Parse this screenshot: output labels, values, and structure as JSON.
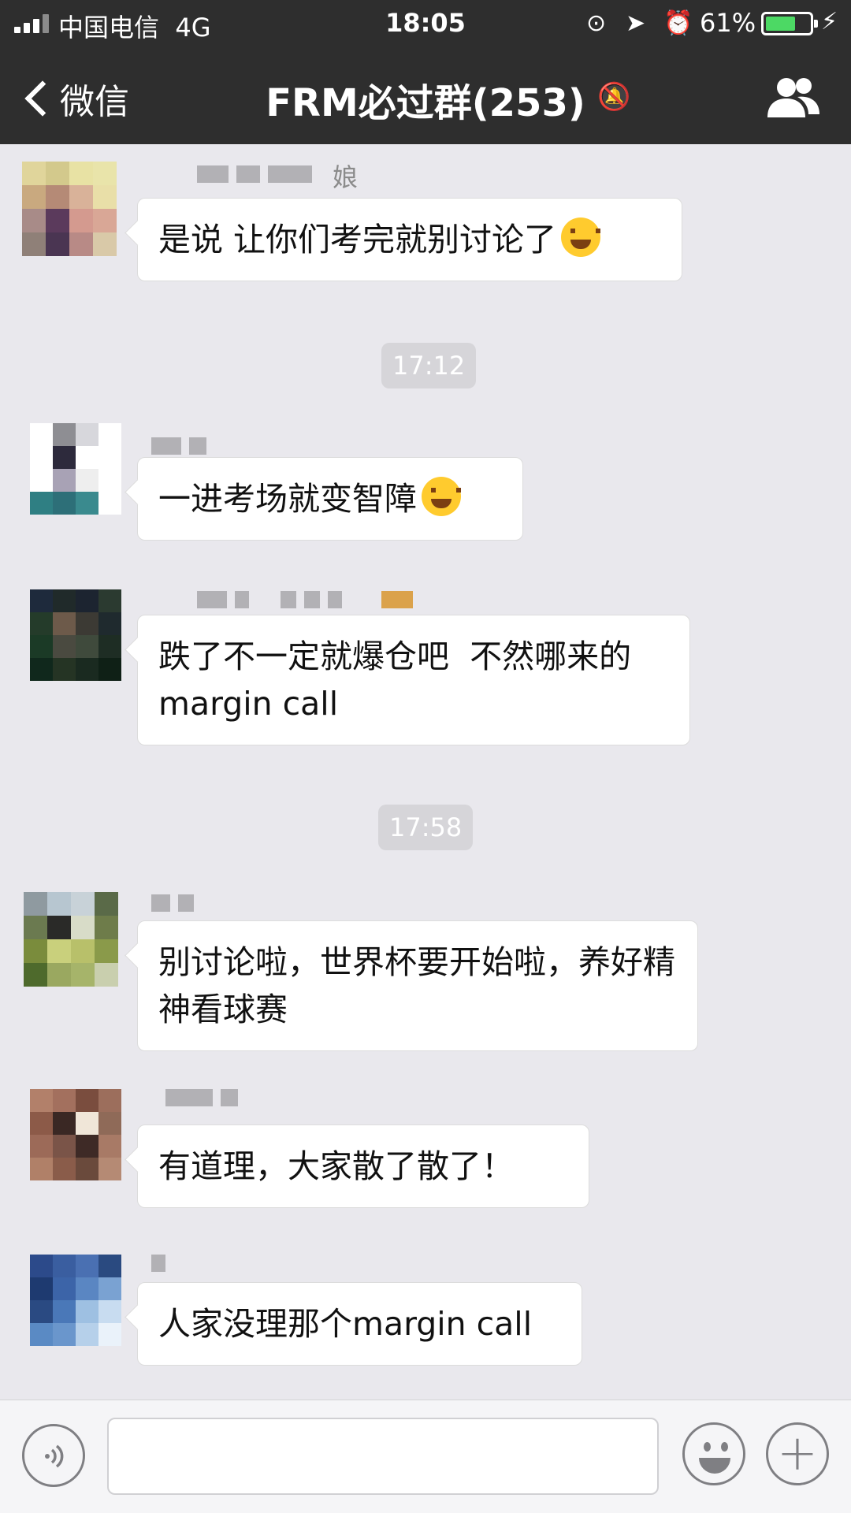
{
  "status_bar": {
    "carrier": "中国电信",
    "network": "4G",
    "time": "18:05",
    "battery_percent": "61%",
    "battery_level": 0.61,
    "icons": [
      "lock-rotation-icon",
      "location-arrow-icon",
      "alarm-icon",
      "charging-bolt-icon"
    ]
  },
  "nav": {
    "back_label": "微信",
    "title": "FRM必过群(253)",
    "mute_icon": "mute-bell-icon",
    "members_icon": "group-members-icon"
  },
  "messages": [
    {
      "name_suffix": "娘",
      "text": "是说 让你们考完就别讨论了",
      "emoji": "grinning-sweat-emoji"
    },
    {
      "text": "一进考场就变智障",
      "emoji": "face-palm-emoji"
    },
    {
      "text": "跌了不一定就爆仓吧  不然哪来的margin call"
    },
    {
      "text": "别讨论啦，世界杯要开始啦，养好精神看球赛"
    },
    {
      "text": "有道理，大家散了散了！"
    },
    {
      "text": "人家没理那个margin call"
    }
  ],
  "timestamps": [
    "17:12",
    "17:58"
  ],
  "input_bar": {
    "voice_icon": "voice-icon",
    "emoji_icon": "emoji-face-icon",
    "plus_icon": "plus-icon"
  },
  "colors": {
    "nav_bg": "#2e2e2e",
    "chat_bg": "#e9e8ed",
    "battery_fill": "#4cd964"
  }
}
